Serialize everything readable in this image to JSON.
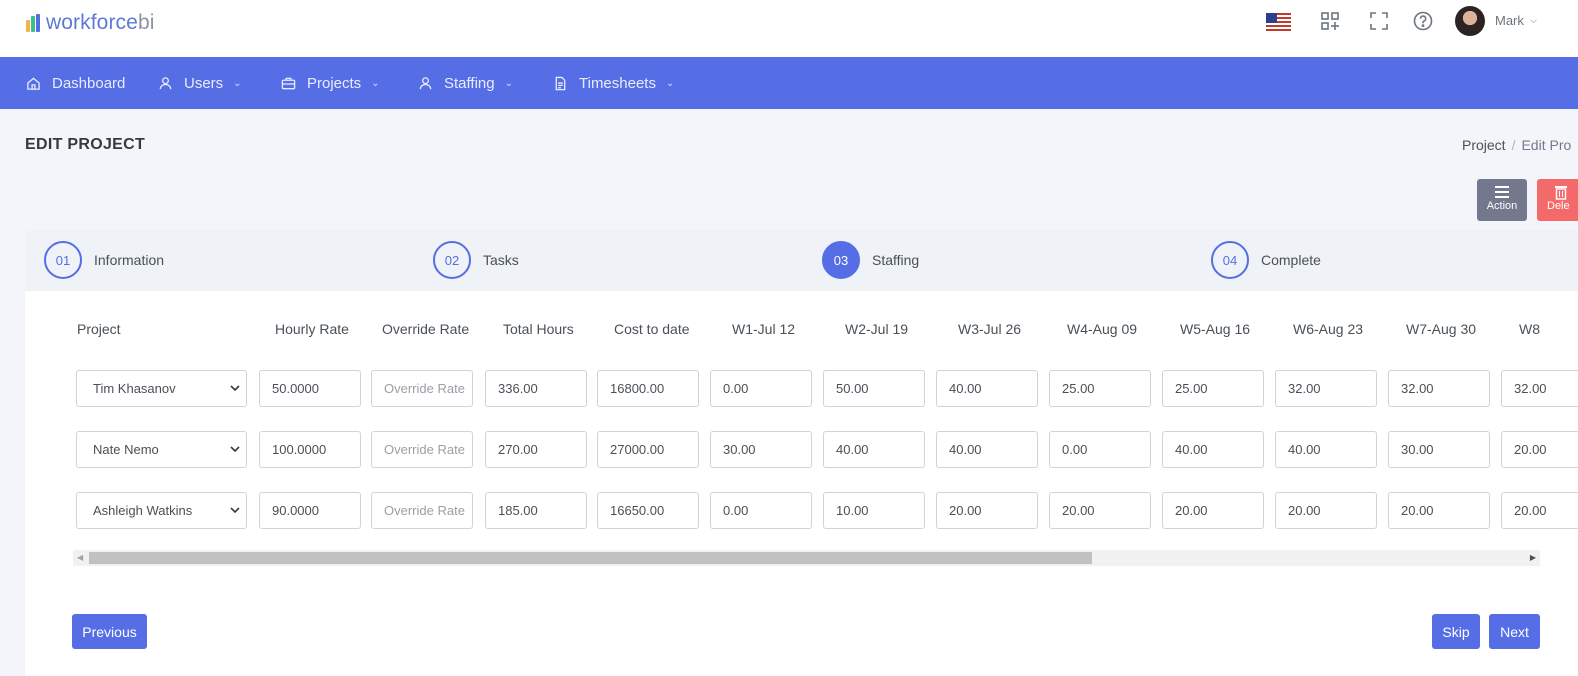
{
  "brand": {
    "name_main": "workforce",
    "name_suffix": "bi"
  },
  "topbar": {
    "user_name": "Mark",
    "flag": "us-flag",
    "icons": [
      "apps-add-icon",
      "fullscreen-icon",
      "help-icon"
    ]
  },
  "nav": {
    "items": [
      {
        "label": "Dashboard",
        "icon": "home-icon"
      },
      {
        "label": "Users",
        "icon": "user-icon"
      },
      {
        "label": "Projects",
        "icon": "briefcase-icon"
      },
      {
        "label": "Staffing",
        "icon": "user-icon"
      },
      {
        "label": "Timesheets",
        "icon": "document-icon"
      }
    ]
  },
  "page": {
    "title": "EDIT PROJECT",
    "breadcrumb": [
      "Project",
      "Edit Pro"
    ],
    "action_label": "Action",
    "delete_label": "Dele"
  },
  "steps": [
    {
      "num": "01",
      "label": "Information"
    },
    {
      "num": "02",
      "label": "Tasks"
    },
    {
      "num": "03",
      "label": "Staffing"
    },
    {
      "num": "04",
      "label": "Complete"
    }
  ],
  "table": {
    "headers": [
      "Project",
      "Hourly Rate",
      "Override Rate",
      "Total Hours",
      "Cost to date",
      "W1-Jul 12",
      "W2-Jul 19",
      "W3-Jul 26",
      "W4-Aug 09",
      "W5-Aug 16",
      "W6-Aug 23",
      "W7-Aug 30",
      "W8"
    ],
    "override_placeholder": "Override Rate",
    "rows": [
      {
        "name": "Tim Khasanov",
        "hourly": "50.0000",
        "total": "336.00",
        "cost": "16800.00",
        "weeks": [
          "0.00",
          "50.00",
          "40.00",
          "25.00",
          "25.00",
          "32.00",
          "32.00",
          "32.00"
        ]
      },
      {
        "name": "Nate Nemo",
        "hourly": "100.0000",
        "total": "270.00",
        "cost": "27000.00",
        "weeks": [
          "30.00",
          "40.00",
          "40.00",
          "0.00",
          "40.00",
          "40.00",
          "30.00",
          "20.00"
        ]
      },
      {
        "name": "Ashleigh Watkins",
        "hourly": "90.0000",
        "total": "185.00",
        "cost": "16650.00",
        "weeks": [
          "0.00",
          "10.00",
          "20.00",
          "20.00",
          "20.00",
          "20.00",
          "20.00",
          "20.00"
        ]
      }
    ]
  },
  "buttons": {
    "previous": "Previous",
    "skip": "Skip",
    "next": "Next"
  },
  "colors": {
    "primary": "#556ee6",
    "secondary": "#74788d",
    "danger": "#f46a6a",
    "step_bg": "#eff2f7"
  }
}
